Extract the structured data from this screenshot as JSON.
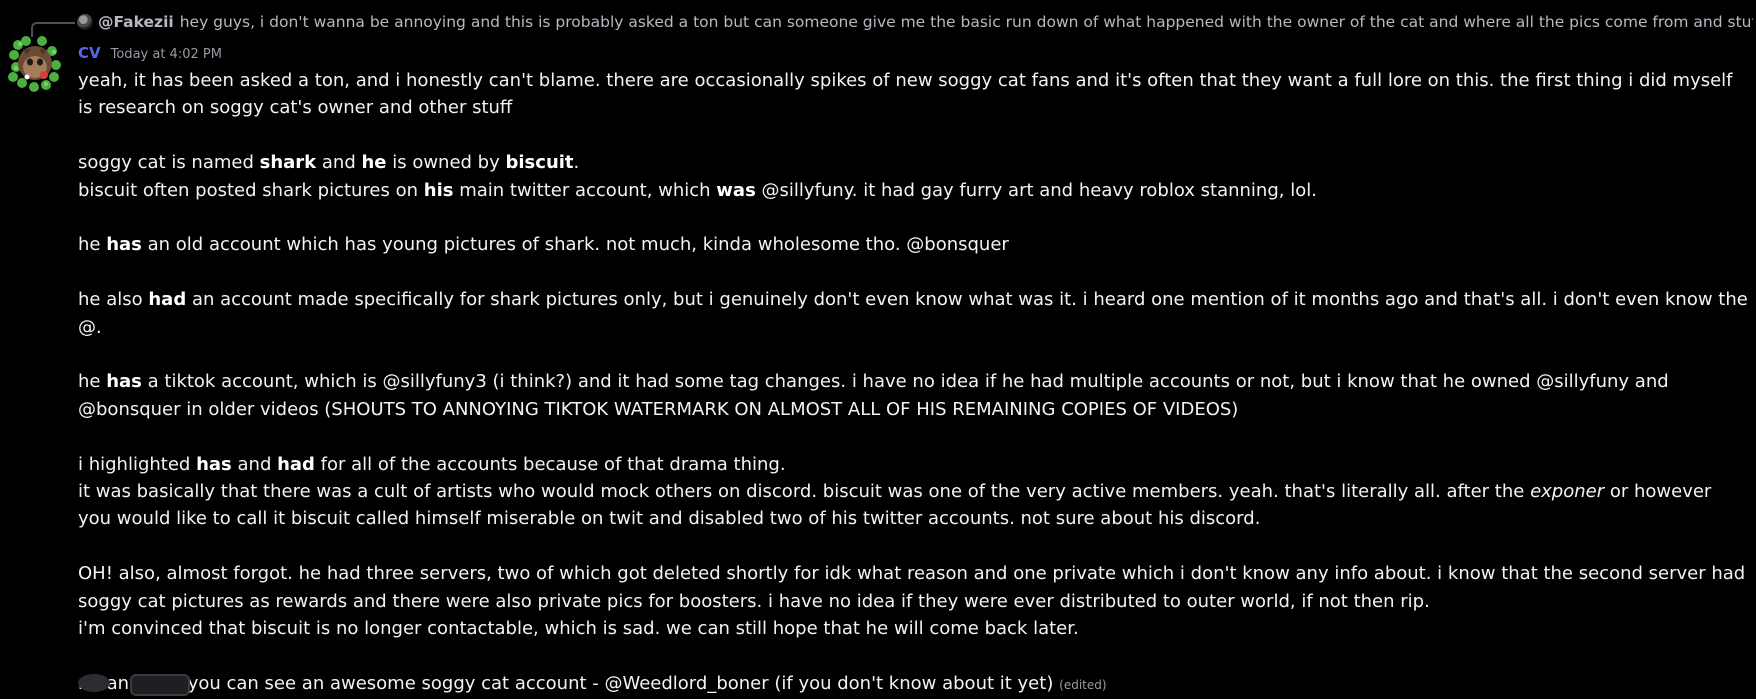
{
  "reply": {
    "author": "@Fakezii",
    "text": "hey guys, i don't wanna be annoying and this is probably asked a ton but can someone give me the basic run down of what happened with the owner of the cat and where all the pics come from and stuff"
  },
  "message": {
    "author": "CV",
    "timestamp": "Today at 4:02 PM",
    "edited_label": "(edited)",
    "paragraphs": [
      [
        {
          "t": "yeah, it has been asked a ton, and i honestly can't blame. there are occasionally spikes of new soggy cat fans and it's often that they want a full lore on this. the first thing i did myself is research on soggy cat's owner and other stuff"
        }
      ],
      [
        {
          "t": "soggy cat is named "
        },
        {
          "t": "shark",
          "b": true
        },
        {
          "t": " and "
        },
        {
          "t": "he",
          "b": true
        },
        {
          "t": " is owned by "
        },
        {
          "t": "biscuit",
          "b": true
        },
        {
          "t": "."
        },
        {
          "br": true
        },
        {
          "t": "biscuit often posted shark pictures on "
        },
        {
          "t": "his",
          "b": true
        },
        {
          "t": " main twitter account, which "
        },
        {
          "t": "was",
          "b": true
        },
        {
          "t": " @sillyfuny. it had gay furry art and heavy roblox stanning, lol."
        }
      ],
      [
        {
          "t": "he "
        },
        {
          "t": "has",
          "b": true
        },
        {
          "t": " an old account which has young pictures of shark. not much, kinda wholesome tho. @bonsquer"
        }
      ],
      [
        {
          "t": "he also "
        },
        {
          "t": "had",
          "b": true
        },
        {
          "t": " an account made specifically for shark pictures only, but i genuinely don't even know what was it. i heard one mention of it months ago and that's all. i don't even know the @."
        }
      ],
      [
        {
          "t": "he "
        },
        {
          "t": "has",
          "b": true
        },
        {
          "t": " a tiktok account, which is @sillyfuny3 (i think?) and it had some tag changes. i have no idea if he had multiple accounts or not, but i know that he owned @sillyfuny and @bonsquer in older videos (SHOUTS TO ANNOYING TIKTOK WATERMARK ON ALMOST ALL OF HIS REMAINING COPIES OF VIDEOS)"
        }
      ],
      [
        {
          "t": "i highlighted "
        },
        {
          "t": "has",
          "b": true
        },
        {
          "t": " and "
        },
        {
          "t": "had",
          "b": true
        },
        {
          "t": " for all of the accounts because of that drama thing."
        },
        {
          "br": true
        },
        {
          "t": "it was basically that there was a cult of artists who would mock others on discord. biscuit was one of the very active members. yeah. that's literally all. after the "
        },
        {
          "t": "exponer",
          "i": true
        },
        {
          "t": " or however you would like to call it biscuit called himself miserable on twit and disabled two of his twitter accounts. not sure about his discord."
        }
      ],
      [
        {
          "t": "OH! also, almost forgot. he had three servers, two of which got deleted shortly for idk what reason and one private which i don't know any info about. i know that the second server had soggy cat pictures as rewards and there were also private pics for boosters. i have no idea if they were ever distributed to outer world, if not then rip."
        },
        {
          "br": true
        },
        {
          "t": "i'm convinced that biscuit is no longer contactable, which is sad. we can still hope that he will come back later."
        }
      ],
      [
        {
          "t": "meanwhile, you can see an awesome soggy cat account - @Weedlord_boner (if you don't know about it yet)"
        }
      ]
    ]
  },
  "colors": {
    "background": "#000000",
    "username": "#5865f2",
    "text": "#f2f3f5",
    "muted": "#949ba4"
  },
  "icons": [
    "reply-avatar-icon",
    "clover-avatar-icon",
    "reaction-icon",
    "attachment-icon"
  ]
}
